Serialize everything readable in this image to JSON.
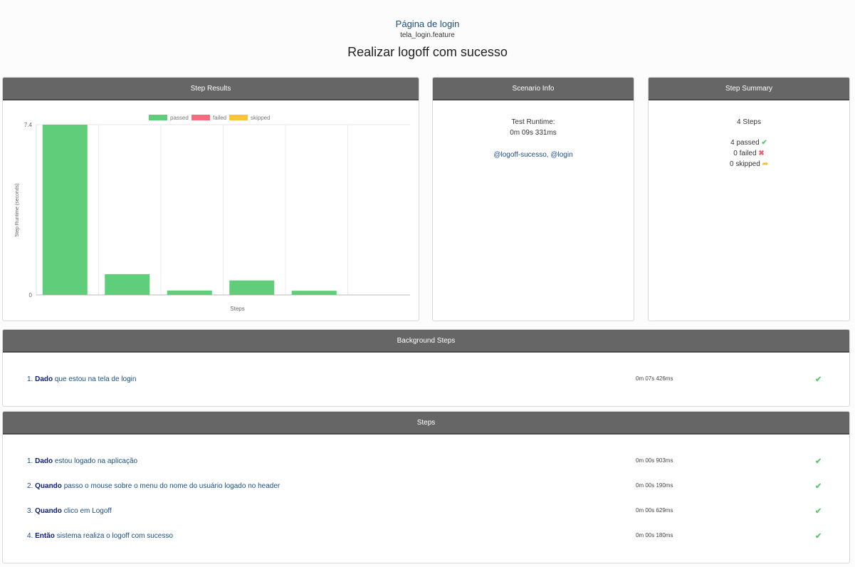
{
  "header": {
    "feature_name": "Página de login",
    "feature_file": "tela_login.feature",
    "scenario_title": "Realizar logoff com sucesso"
  },
  "step_results": {
    "title": "Step Results",
    "legend": [
      {
        "label": "passed",
        "color": "#5fcd79"
      },
      {
        "label": "failed",
        "color": "#f26e7f"
      },
      {
        "label": "skipped",
        "color": "#f6c53d"
      }
    ]
  },
  "chart_data": {
    "type": "bar",
    "categories": [
      "",
      "",
      "",
      "",
      "",
      ""
    ],
    "series": [
      {
        "values": [
          7.426,
          0.903,
          0.19,
          0.629,
          0.18,
          null
        ],
        "color": "#5fcd79"
      }
    ],
    "xlabel": "Steps",
    "ylabel": "Step Runtime (seconds)",
    "ylim": [
      0,
      7.4
    ],
    "yticks": [
      "0",
      "7.4"
    ],
    "grid": true,
    "legend_position": "top"
  },
  "scenario_info": {
    "title": "Scenario Info",
    "runtime_label": "Test Runtime:",
    "runtime_value": "0m 09s 331ms",
    "tags": "@logoff-sucesso, @login"
  },
  "step_summary": {
    "title": "Step Summary",
    "total": "4 Steps",
    "passed": "4 passed",
    "failed": "0 failed",
    "skipped": "0 skipped",
    "icons": {
      "passed": "check-icon",
      "failed": "cross-icon",
      "skipped": "forward-arrow-icon"
    }
  },
  "background_steps": {
    "title": "Background Steps",
    "items": [
      {
        "num": "1.",
        "keyword": "Dado",
        "text": "que estou na tela de login",
        "time": "0m 07s 426ms",
        "status": "passed"
      }
    ]
  },
  "steps": {
    "title": "Steps",
    "items": [
      {
        "num": "1.",
        "keyword": "Dado",
        "text": "estou logado na aplicação",
        "time": "0m 00s 903ms",
        "status": "passed"
      },
      {
        "num": "2.",
        "keyword": "Quando",
        "text": "passo o mouse sobre o menu do nome do usuário logado no header",
        "time": "0m 00s 190ms",
        "status": "passed"
      },
      {
        "num": "3.",
        "keyword": "Quando",
        "text": "clico em Logoff",
        "time": "0m 00s 629ms",
        "status": "passed"
      },
      {
        "num": "4.",
        "keyword": "Então",
        "text": "sistema realiza o logoff com sucesso",
        "time": "0m 00s 180ms",
        "status": "passed"
      }
    ]
  }
}
